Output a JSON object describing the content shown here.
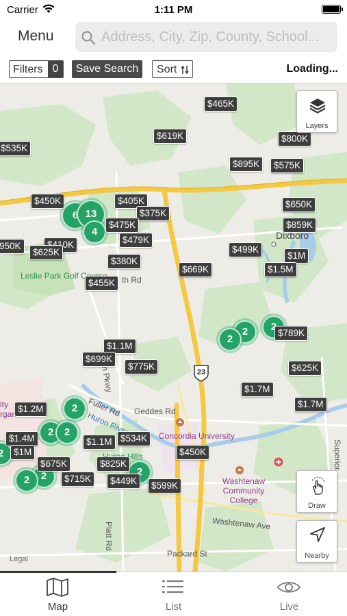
{
  "status_bar": {
    "carrier": "Carrier",
    "time": "1:11 PM"
  },
  "header": {
    "menu_label": "Menu",
    "search_placeholder": "Address, City, Zip, County, School...",
    "search_value": ""
  },
  "toolbar": {
    "filters_label": "Filters",
    "filters_count": "0",
    "save_search_label": "Save Search",
    "sort_label": "Sort",
    "status_text": "Loading..."
  },
  "map": {
    "controls": {
      "layers_label": "Layers",
      "draw_label": "Draw",
      "nearby_label": "Nearby"
    },
    "price_tags": [
      "$465K",
      "$619K",
      "$800K",
      "$535K",
      "$895K",
      "$575K",
      "$450K",
      "$405K",
      "$375K",
      "$650K",
      "$475K",
      "$859K",
      "$479K",
      "950K",
      "$410K",
      "$625K",
      "$499K",
      "$1M",
      "$380K",
      "$669K",
      "$1.5M",
      "$455K",
      "$789K",
      "$1.1M",
      "$699K",
      "$775K",
      "$625K",
      "$1.7M",
      "$1.7M",
      "$1.2M",
      "$1.4M",
      "$534K",
      "$1.1M",
      "$1M",
      "$450K",
      "$675K",
      "$825K",
      "$715K",
      "$449K",
      "$599K"
    ],
    "clusters": [
      "6",
      "13",
      "4",
      "2",
      "2",
      "2",
      "2",
      "2",
      "2",
      "2",
      "2",
      "2",
      "2"
    ],
    "labels": {
      "dixboro": "Dixboro",
      "leslie_park": "Leslie Park Golf Course",
      "concordia": "Concordia University",
      "washtenaw_cc": "Washtenaw Community College",
      "huron_hills": "Huron Hills",
      "fuller_rd": "Fuller Rd",
      "huron_river": "Huron River",
      "geddes_rd": "Geddes Rd",
      "washtenaw_ave": "Washtenaw Ave",
      "packard_st": "Packard St",
      "platt_rd": "Platt Rd",
      "superior": "Superior",
      "pkwy": "n Pkwy",
      "th_rd": "th Rd",
      "city": "ity",
      "arbor": "rgan",
      "route_23": "23",
      "legal": "Legal"
    }
  },
  "tabs": [
    {
      "label": "Map",
      "icon": "map-icon",
      "active": true
    },
    {
      "label": "List",
      "icon": "list-icon",
      "active": false
    },
    {
      "label": "Live",
      "icon": "eye-icon",
      "active": false
    }
  ],
  "colors": {
    "cluster": "#24a366",
    "price_tag": "#3d3d3d",
    "highway": "#f5c842",
    "park": "#cfe6c4",
    "water": "#a8cde8"
  }
}
